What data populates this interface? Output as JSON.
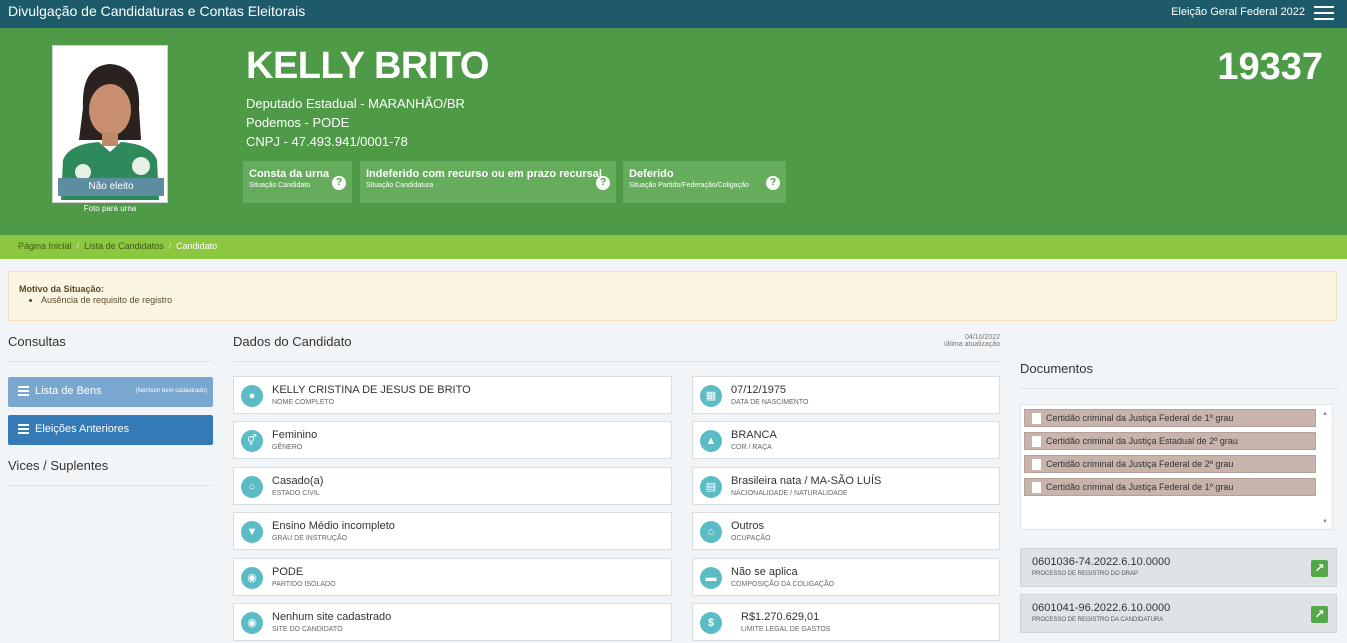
{
  "topbar": {
    "title": "Divulgação de Candidaturas e Contas Eleitorais",
    "election": "Eleição Geral Federal 2022"
  },
  "candidate": {
    "name": "KELLY BRITO",
    "office": "Deputado Estadual - MARANHÃO/BR",
    "party": "Podemos - PODE",
    "cnpj": "CNPJ - 47.493.941/0001-78",
    "number": "19337",
    "photo_status": "Não eleito",
    "photo_caption": "Foto para urna"
  },
  "chips": [
    {
      "label": "Consta da urna",
      "sub": "Situação Candidato"
    },
    {
      "label": "Indeferido com recurso ou em prazo recursal",
      "sub": "Situação Candidatura"
    },
    {
      "label": "Deferido",
      "sub": "Situação Partido/Federação/Coligação"
    }
  ],
  "breadcrumb": [
    "Página Inicial",
    "Lista de Candidatos",
    "Candidato"
  ],
  "alert": {
    "title": "Motivo da Situação:",
    "item": "Ausência de requisito de registro"
  },
  "consultas": {
    "title": "Consultas",
    "bens_label": "Lista de Bens",
    "bens_note": "(Nenhum bem cadastrado)",
    "eleicoes_label": "Eleições Anteriores",
    "vices_title": "Vices / Suplentes"
  },
  "dados": {
    "title": "Dados do Candidato",
    "date": "04/10/2022",
    "date_label": "última atualização",
    "fields": [
      {
        "value": "KELLY CRISTINA DE JESUS DE BRITO",
        "label": "NOME COMPLETO",
        "icon": "user-icon"
      },
      {
        "value": "07/12/1975",
        "label": "DATA DE NASCIMENTO",
        "icon": "calendar-icon"
      },
      {
        "value": "Feminino",
        "label": "GÊNERO",
        "icon": "gender-icon"
      },
      {
        "value": "BRANCA",
        "label": "COR / RAÇA",
        "icon": "shirt-icon"
      },
      {
        "value": "Casado(a)",
        "label": "ESTADO CIVIL",
        "icon": "ring-icon"
      },
      {
        "value": "Brasileira nata / MA-SÃO LUÍS",
        "label": "NACIONALIDADE / NATURALIDADE",
        "icon": "map-icon"
      },
      {
        "value": "Ensino Médio incompleto",
        "label": "GRAU DE INSTRUÇÃO",
        "icon": "graduation-cap-icon"
      },
      {
        "value": "Outros",
        "label": "OCUPAÇÃO",
        "icon": "institution-icon"
      },
      {
        "value": "PODE",
        "label": "PARTIDO ISOLADO",
        "icon": "people-icon"
      },
      {
        "value": "Não se aplica",
        "label": "COMPOSIÇÃO DA COLIGAÇÃO",
        "icon": "folder-icon"
      },
      {
        "value": "Nenhum site cadastrado",
        "label": "SITE DO CANDIDATO",
        "icon": "globe-icon"
      },
      {
        "value": "R$1.270.629,01",
        "label": "LIMITE LEGAL DE GASTOS",
        "icon": "dollar-icon"
      }
    ]
  },
  "documentos": {
    "title": "Documentos",
    "items": [
      "Certidão criminal da Justiça Federal de 1º grau",
      "Certidão criminal da Justiça Estadual de 2º grau",
      "Certidão criminal da Justiça Federal de 2º grau",
      "Certidão criminal da Justiça Federal de 1º grau"
    ],
    "processos": [
      {
        "value": "0601036-74.2022.6.10.0000",
        "label": "PROCESSO DE REGISTRO DO DRAP"
      },
      {
        "value": "0601041-96.2022.6.10.0000",
        "label": "PROCESSO DE REGISTRO DA CANDIDATURA"
      }
    ]
  }
}
